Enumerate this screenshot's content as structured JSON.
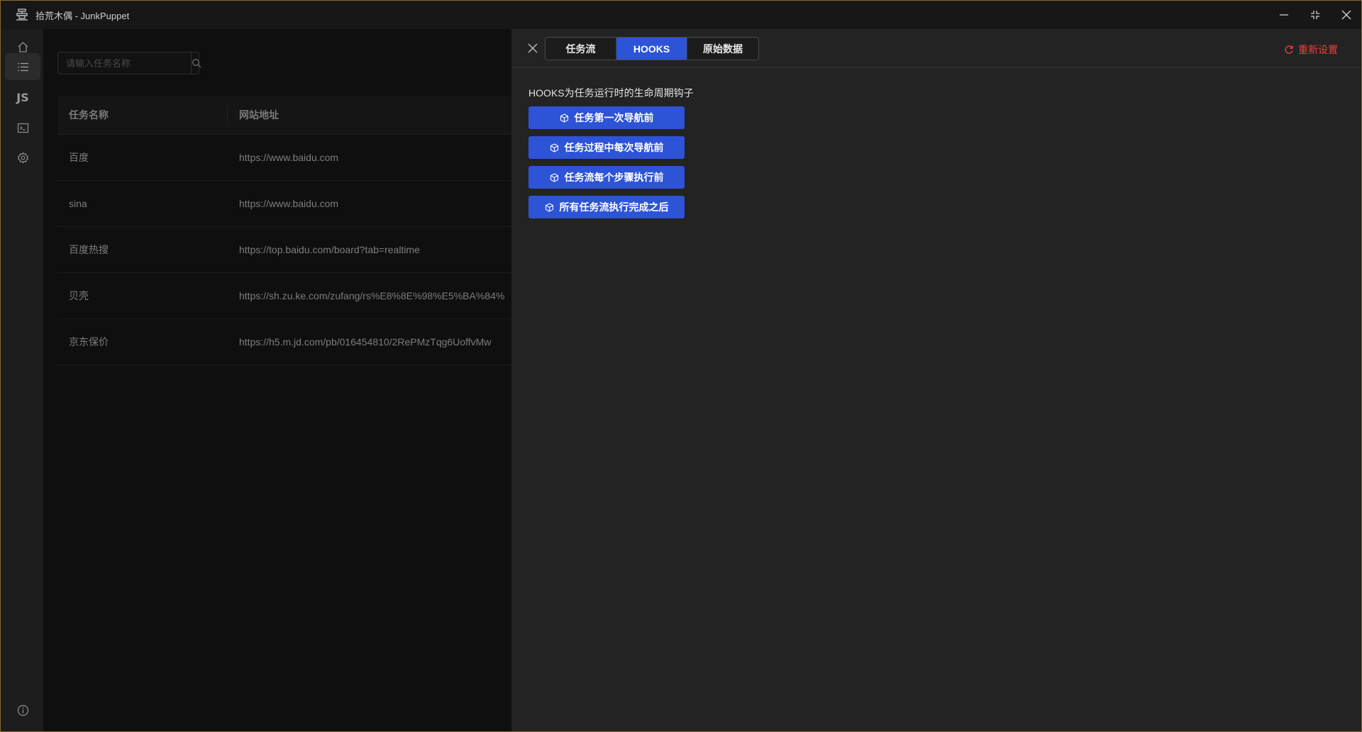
{
  "window": {
    "title": "拾荒木偶 - JunkPuppet"
  },
  "sidebar": {
    "items": [
      {
        "icon": "home-icon"
      },
      {
        "icon": "list-icon",
        "active": true
      },
      {
        "icon": "js-icon",
        "label": "JS"
      },
      {
        "icon": "terminal-icon"
      },
      {
        "icon": "gear-icon"
      },
      {
        "icon": "info-icon"
      }
    ]
  },
  "search": {
    "placeholder": "请输入任务名称"
  },
  "table": {
    "columns": [
      "任务名称",
      "网站地址"
    ],
    "rows": [
      {
        "name": "百度",
        "url": "https://www.baidu.com"
      },
      {
        "name": "sina",
        "url": "https://www.baidu.com"
      },
      {
        "name": "百度热搜",
        "url": "https://top.baidu.com/board?tab=realtime"
      },
      {
        "name": "贝壳",
        "url": "https://sh.zu.ke.com/zufang/rs%E8%8E%98%E5%BA%84%"
      },
      {
        "name": "京东保价",
        "url": "https://h5.m.jd.com/pb/016454810/2RePMzTqg6UoffvMw"
      }
    ]
  },
  "drawer": {
    "tabs": [
      {
        "label": "任务流",
        "active": false
      },
      {
        "label": "HOOKS",
        "active": true
      },
      {
        "label": "原始数据",
        "active": false
      }
    ],
    "reset_label": "重新设置",
    "hooks_description": "HOOKS为任务运行时的生命周期钩子",
    "hooks": [
      {
        "label": "任务第一次导航前"
      },
      {
        "label": "任务过程中每次导航前"
      },
      {
        "label": "任务流每个步骤执行前"
      },
      {
        "label": "所有任务流执行完成之后"
      }
    ]
  },
  "colors": {
    "accent": "#2d53d6",
    "danger": "#e8423a",
    "window_border": "#8a6a2a"
  }
}
